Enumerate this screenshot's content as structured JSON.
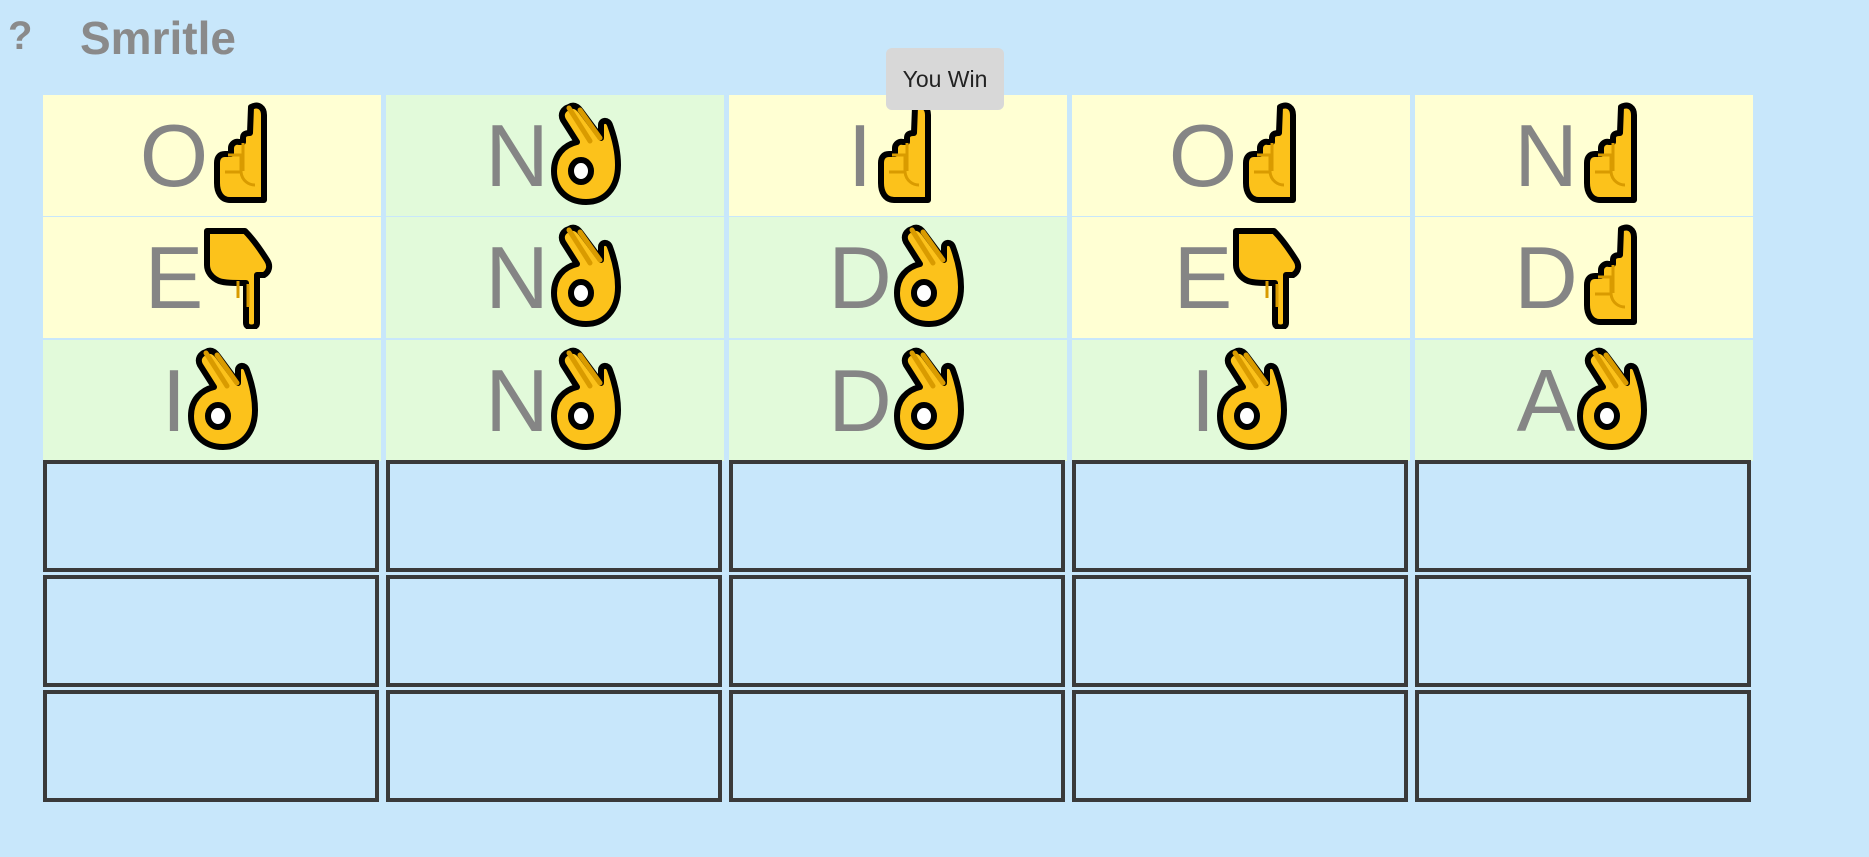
{
  "header": {
    "help_label": "?",
    "title": "Smritle"
  },
  "result": {
    "label": "You Win"
  },
  "board": {
    "rows": [
      {
        "cells": [
          {
            "letter": "O",
            "status": "present",
            "icon": "point-up-icon"
          },
          {
            "letter": "N",
            "status": "correct",
            "icon": "ok-hand-icon"
          },
          {
            "letter": "I",
            "status": "present",
            "icon": "point-up-icon"
          },
          {
            "letter": "O",
            "status": "present",
            "icon": "point-up-icon"
          },
          {
            "letter": "N",
            "status": "present",
            "icon": "point-up-icon"
          }
        ]
      },
      {
        "cells": [
          {
            "letter": "E",
            "status": "absent",
            "icon": "point-down-icon"
          },
          {
            "letter": "N",
            "status": "correct",
            "icon": "ok-hand-icon"
          },
          {
            "letter": "D",
            "status": "correct",
            "icon": "ok-hand-icon"
          },
          {
            "letter": "E",
            "status": "absent",
            "icon": "point-down-icon"
          },
          {
            "letter": "D",
            "status": "present",
            "icon": "point-up-icon"
          }
        ]
      },
      {
        "cells": [
          {
            "letter": "I",
            "status": "correct",
            "icon": "ok-hand-icon"
          },
          {
            "letter": "N",
            "status": "correct",
            "icon": "ok-hand-icon"
          },
          {
            "letter": "D",
            "status": "correct",
            "icon": "ok-hand-icon"
          },
          {
            "letter": "I",
            "status": "correct",
            "icon": "ok-hand-icon"
          },
          {
            "letter": "A",
            "status": "correct",
            "icon": "ok-hand-icon"
          }
        ]
      },
      {
        "cells": [
          {},
          {},
          {},
          {},
          {}
        ]
      },
      {
        "cells": [
          {},
          {},
          {},
          {},
          {}
        ]
      },
      {
        "cells": [
          {},
          {},
          {},
          {},
          {}
        ]
      }
    ]
  },
  "colors": {
    "background": "#c8e7fb",
    "present_tile": "#ffffd3",
    "correct_tile": "#e2fada",
    "empty_border": "#3a3a3a",
    "letter": "#858585",
    "hand_fill": "#fcc21b",
    "hand_outline": "#000000"
  }
}
